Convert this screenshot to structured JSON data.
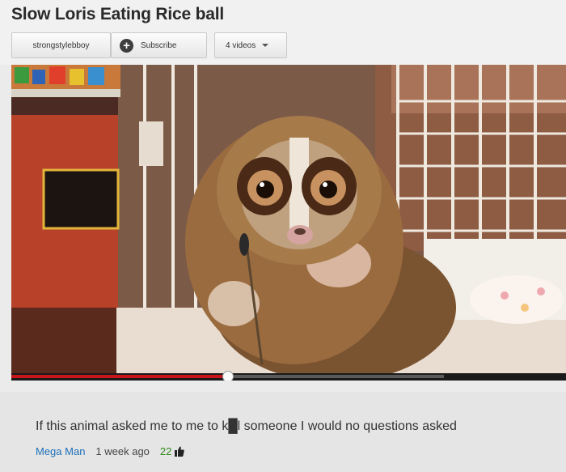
{
  "video": {
    "title": "Slow Loris Eating Rice ball",
    "channel": "strongstylebboy",
    "subscribe_label": "Subscribe",
    "videos_count": "4 videos",
    "progress": 0.39
  },
  "comment": {
    "text": "If this animal asked me to me to k█l someone I would no questions asked",
    "author": "Mega Man",
    "time": "1 week ago",
    "likes": "22"
  },
  "icons": {
    "subscribe": "plus-circle-icon",
    "videos_dropdown": "chevron-down-icon",
    "likes": "thumbs-up-icon"
  },
  "colors": {
    "progress": "#c8151c",
    "author": "#1e6fb8",
    "likes": "#2e8a1c"
  }
}
